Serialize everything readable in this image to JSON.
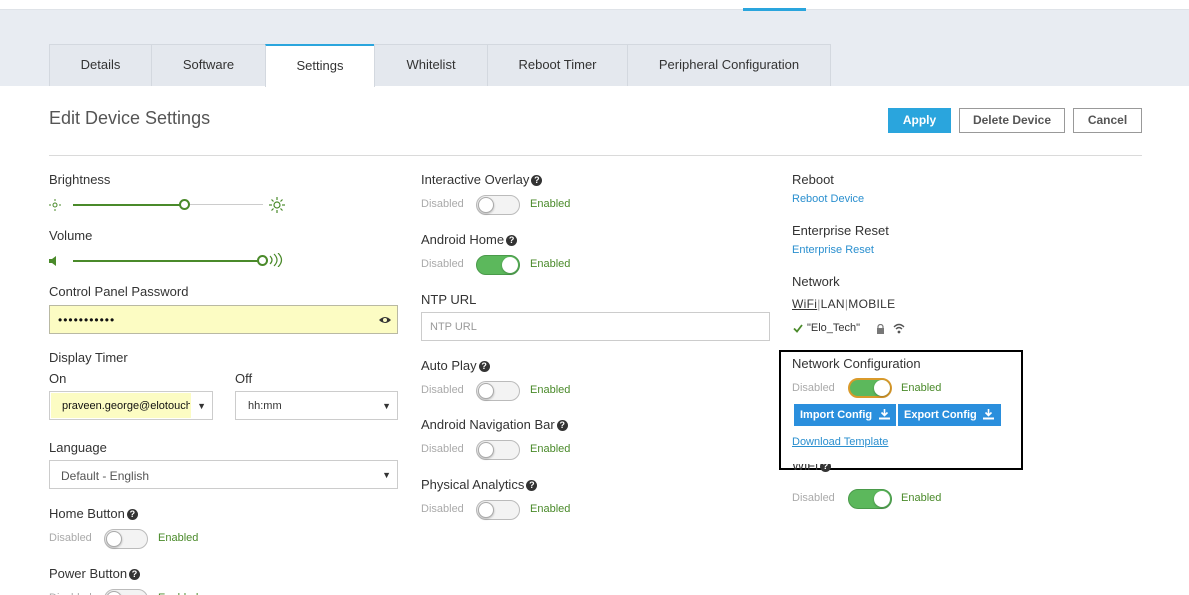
{
  "tabs": [
    {
      "label": "Details"
    },
    {
      "label": "Software"
    },
    {
      "label": "Settings"
    },
    {
      "label": "Whitelist"
    },
    {
      "label": "Reboot Timer"
    },
    {
      "label": "Peripheral Configuration"
    }
  ],
  "active_tab": "Settings",
  "page_title": "Edit Device Settings",
  "actions": {
    "apply": "Apply",
    "delete": "Delete Device",
    "cancel": "Cancel"
  },
  "brightness": {
    "label": "Brightness",
    "value_fraction": 0.61
  },
  "volume": {
    "label": "Volume",
    "value_fraction": 1.0
  },
  "control_panel_password": {
    "label": "Control Panel Password",
    "value": "•••••••••••"
  },
  "display_timer": {
    "label": "Display Timer",
    "on_label": "On",
    "on_value": "praveen.george@elotouch",
    "off_label": "Off",
    "off_value": "hh:mm"
  },
  "language": {
    "label": "Language",
    "value": "Default - English"
  },
  "toggle_text": {
    "disabled": "Disabled",
    "enabled": "Enabled"
  },
  "home_button": {
    "label": "Home Button",
    "enabled": false
  },
  "power_button": {
    "label": "Power Button",
    "enabled": false
  },
  "interactive_overlay": {
    "label": "Interactive Overlay",
    "enabled": false
  },
  "android_home": {
    "label": "Android Home",
    "enabled": true
  },
  "ntp_url": {
    "label": "NTP URL",
    "placeholder": "NTP URL",
    "value": ""
  },
  "auto_play": {
    "label": "Auto Play",
    "enabled": false
  },
  "android_nav_bar": {
    "label": "Android Navigation Bar",
    "enabled": false
  },
  "physical_analytics": {
    "label": "Physical Analytics",
    "enabled": false
  },
  "reboot": {
    "label": "Reboot",
    "link": "Reboot Device"
  },
  "enterprise_reset": {
    "label": "Enterprise Reset",
    "link": "Enterprise Reset"
  },
  "network": {
    "label": "Network",
    "modes": [
      "WiFi",
      "LAN",
      "MOBILE"
    ],
    "active_mode": "WiFi",
    "ssid": "\"Elo_Tech\""
  },
  "network_configuration": {
    "label": "Network Configuration",
    "enabled": true,
    "import_label": "Import Config",
    "export_label": "Export Config",
    "template_link": "Download Template"
  },
  "wifi": {
    "label": "WiFi",
    "enabled": true
  },
  "colors": {
    "accent": "#2aa5dd",
    "enabled_green": "#5cb85c",
    "link_blue": "#2a8fcf",
    "password_bg": "#fcfcc3"
  }
}
